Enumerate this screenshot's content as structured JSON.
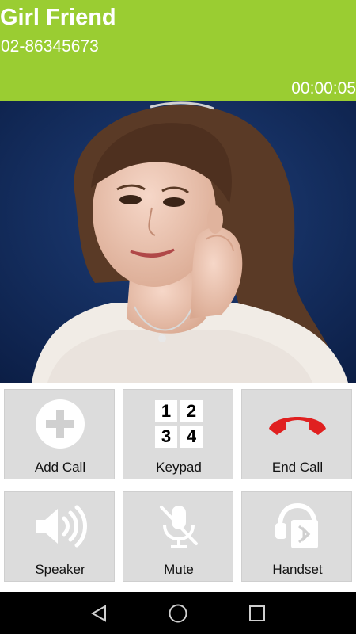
{
  "call": {
    "name": "Girl Friend",
    "number": "02-86345673",
    "timer": "00:00:05"
  },
  "colors": {
    "header_bg": "#9acd32",
    "end_call": "#e02020",
    "icon_gray": "#ffffff"
  },
  "photo": {
    "description_icon": "contact-photo"
  },
  "buttons": [
    {
      "label": "Add Call",
      "icon": "add-icon"
    },
    {
      "label": "Keypad",
      "icon": "keypad-icon",
      "keys": [
        "1",
        "2",
        "3",
        "4"
      ]
    },
    {
      "label": "End Call",
      "icon": "hangup-icon"
    },
    {
      "label": "Speaker",
      "icon": "speaker-icon"
    },
    {
      "label": "Mute",
      "icon": "mic-off-icon"
    },
    {
      "label": "Handset",
      "icon": "bluetooth-handset-icon"
    }
  ],
  "navbar": {
    "items": [
      "back-icon",
      "home-icon",
      "recents-icon"
    ]
  }
}
